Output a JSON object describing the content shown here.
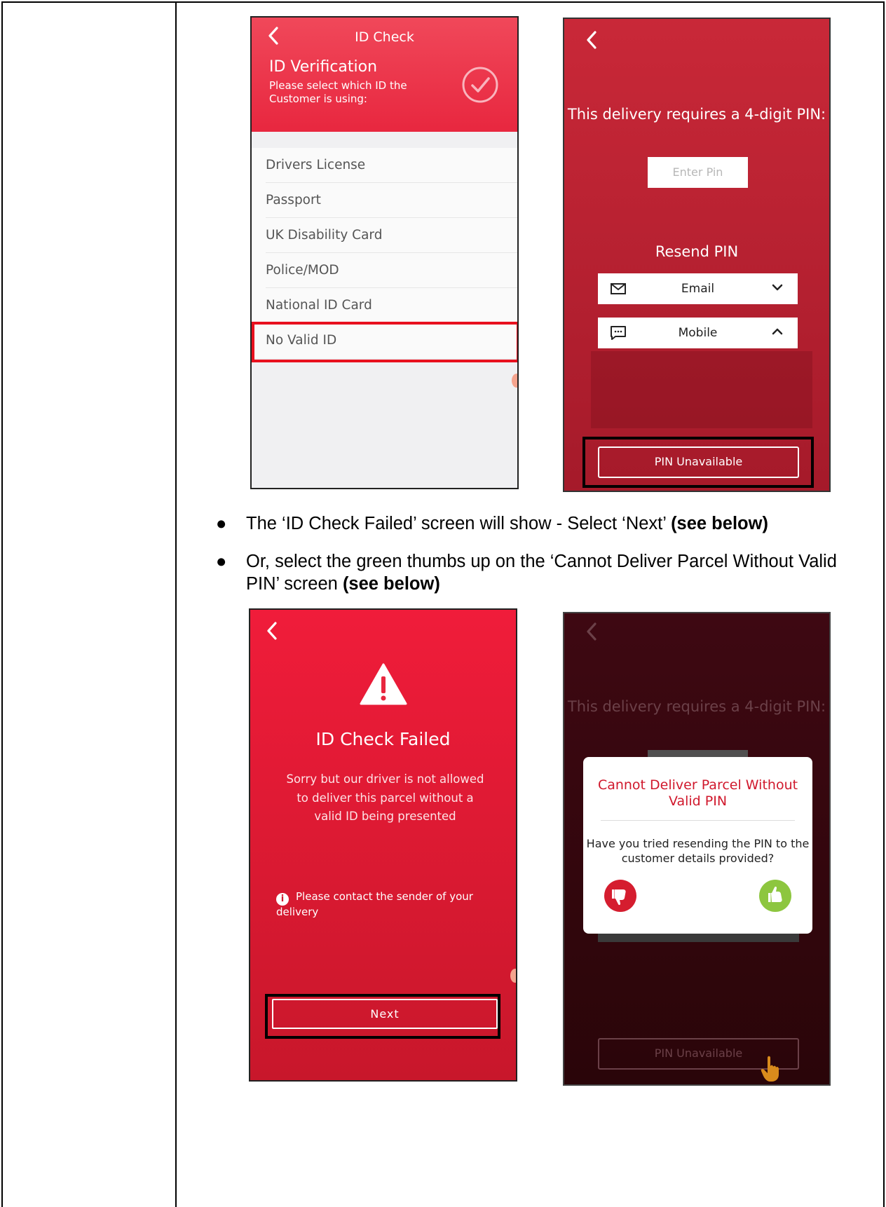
{
  "screen_id_check": {
    "back": "<",
    "title": "ID Check",
    "heading": "ID Verification",
    "subtitle": "Please select which ID the Customer is using:",
    "options": [
      "Drivers License",
      "Passport",
      "UK Disability Card",
      "Police/MOD",
      "National ID Card",
      "No Valid ID"
    ],
    "highlighted_option": "No Valid ID"
  },
  "screen_pin": {
    "back": "<",
    "requirement": "This delivery requires a 4-digit PIN:",
    "pin_placeholder": "Enter Pin",
    "resend_heading": "Resend PIN",
    "email_label": "Email",
    "mobile_label": "Mobile",
    "unavailable_label": "PIN Unavailable"
  },
  "bullets": [
    {
      "text": "The ‘ID Check Failed’ screen will show - Select ‘Next’ ",
      "bold": "(see below)"
    },
    {
      "text": "Or, select the green thumbs up on the ‘Cannot Deliver Parcel Without Valid PIN’ screen ",
      "bold": "(see below)"
    }
  ],
  "screen_failed": {
    "back": "<",
    "heading": "ID Check Failed",
    "message": "Sorry but our driver is not allowed to deliver this parcel without a valid ID being presented",
    "info_icon": "i",
    "info": "Please contact the sender of your delivery",
    "next_label": "Next"
  },
  "screen_cannot_deliver": {
    "back": "<",
    "requirement": "This delivery requires a 4-digit PIN:",
    "modal_title": "Cannot Deliver Parcel Without Valid PIN",
    "modal_question": "Have you tried resending the PIN to the customer details provided?",
    "unavailable_label": "PIN Unavailable"
  },
  "colors": {
    "brand_red": "#e8273f",
    "highlight_red": "#e8101e",
    "thumbs_up_green": "#8dc63f",
    "thumbs_down_red": "#d51d2f"
  },
  "icons": [
    "chevron-left-icon",
    "check-circle-icon",
    "mail-icon",
    "chat-icon",
    "chevron-down-icon",
    "chevron-up-icon",
    "warning-icon",
    "info-icon",
    "thumbs-down-icon",
    "thumbs-up-icon",
    "pointer-hand-icon"
  ]
}
